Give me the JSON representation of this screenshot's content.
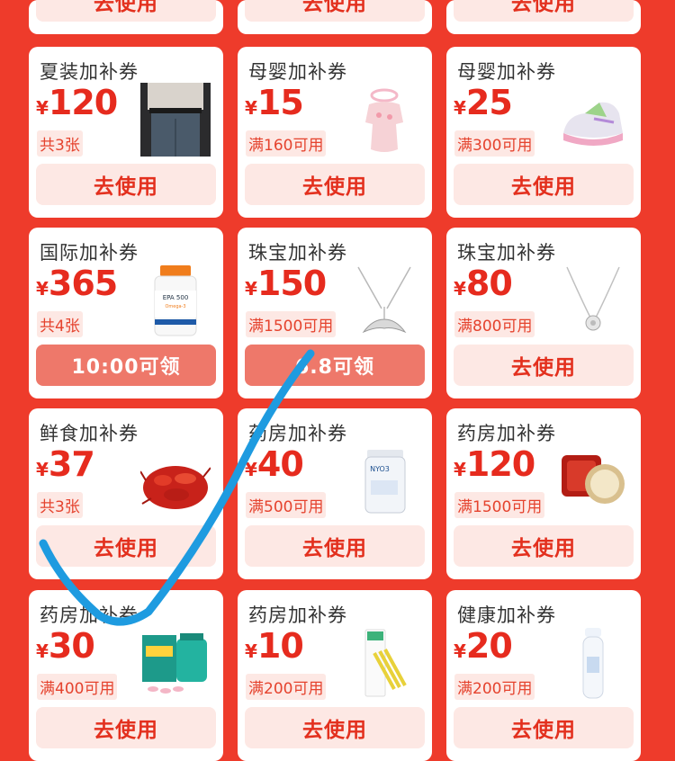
{
  "top_partial_row": [
    {
      "button": "去使用"
    },
    {
      "button": "去使用"
    },
    {
      "button": "去使用"
    }
  ],
  "coupons": [
    {
      "title": "夏装加补券",
      "currency": "¥",
      "amount": "120",
      "condition": "共3张",
      "button": "去使用",
      "button_style": "use",
      "image": "clothing-photo"
    },
    {
      "title": "母婴加补券",
      "currency": "¥",
      "amount": "15",
      "condition": "满160可用",
      "button": "去使用",
      "button_style": "use",
      "image": "baby-romper"
    },
    {
      "title": "母婴加补券",
      "currency": "¥",
      "amount": "25",
      "condition": "满300可用",
      "button": "去使用",
      "button_style": "use",
      "image": "kids-sneaker"
    },
    {
      "title": "国际加补券",
      "currency": "¥",
      "amount": "365",
      "condition": "共4张",
      "button": "10:00可领",
      "button_style": "timer",
      "image": "supplement-bottle"
    },
    {
      "title": "珠宝加补券",
      "currency": "¥",
      "amount": "150",
      "condition": "满1500可用",
      "button": "6.8可领",
      "button_style": "timer",
      "image": "whale-tail-necklace"
    },
    {
      "title": "珠宝加补券",
      "currency": "¥",
      "amount": "80",
      "condition": "满800可用",
      "button": "去使用",
      "button_style": "use",
      "image": "pendant-necklace"
    },
    {
      "title": "鲜食加补券",
      "currency": "¥",
      "amount": "37",
      "condition": "共3张",
      "button": "去使用",
      "button_style": "use",
      "image": "crayfish"
    },
    {
      "title": "药房加补券",
      "currency": "¥",
      "amount": "40",
      "condition": "满500可用",
      "button": "去使用",
      "button_style": "use",
      "image": "fish-oil-jar"
    },
    {
      "title": "药房加补券",
      "currency": "¥",
      "amount": "120",
      "condition": "满1500可用",
      "button": "去使用",
      "button_style": "use",
      "image": "cosmetic-compact"
    },
    {
      "title": "药房加补券",
      "currency": "¥",
      "amount": "30",
      "condition": "满400可用",
      "button": "去使用",
      "button_style": "use",
      "image": "calcium-tablets"
    },
    {
      "title": "药房加补券",
      "currency": "¥",
      "amount": "10",
      "condition": "满200可用",
      "button": "去使用",
      "button_style": "use",
      "image": "interdental-brushes"
    },
    {
      "title": "健康加补券",
      "currency": "¥",
      "amount": "20",
      "condition": "满200可用",
      "button": "去使用",
      "button_style": "use",
      "image": "spray-bottle"
    }
  ],
  "colors": {
    "page_bg": "#ee3b2b",
    "price_red": "#e62b1e",
    "button_bg": "#fde8e4",
    "timer_button_bg": "#ee786a",
    "check_stroke": "#1e9be0"
  },
  "overlay": {
    "type": "hand-drawn-checkmark",
    "color": "#1e9be0"
  }
}
